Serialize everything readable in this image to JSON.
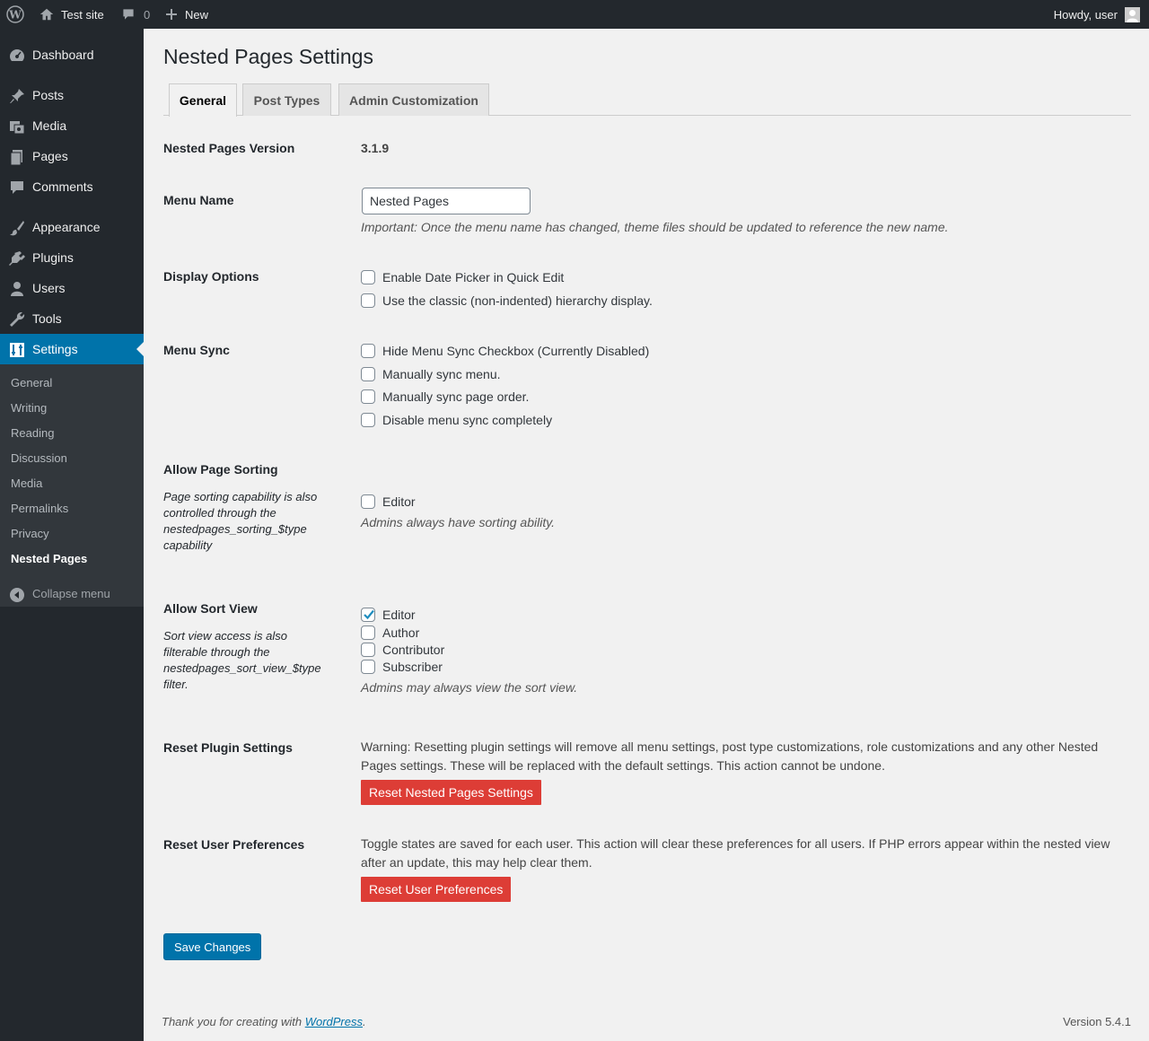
{
  "adminbar": {
    "site_name": "Test site",
    "comments_count": "0",
    "new_label": "New",
    "howdy": "Howdy, user"
  },
  "sidebar": {
    "items": [
      {
        "label": "Dashboard",
        "icon": "dashboard-icon"
      },
      {
        "label": "Posts",
        "icon": "pin-icon"
      },
      {
        "label": "Media",
        "icon": "media-icon"
      },
      {
        "label": "Pages",
        "icon": "pages-icon"
      },
      {
        "label": "Comments",
        "icon": "comment-icon"
      },
      {
        "label": "Appearance",
        "icon": "brush-icon"
      },
      {
        "label": "Plugins",
        "icon": "plug-icon"
      },
      {
        "label": "Users",
        "icon": "user-icon"
      },
      {
        "label": "Tools",
        "icon": "wrench-icon"
      },
      {
        "label": "Settings",
        "icon": "settings-icon"
      }
    ],
    "submenu": [
      "General",
      "Writing",
      "Reading",
      "Discussion",
      "Media",
      "Permalinks",
      "Privacy",
      "Nested Pages"
    ],
    "collapse": "Collapse menu"
  },
  "page": {
    "title": "Nested Pages Settings",
    "tabs": [
      "General",
      "Post Types",
      "Admin Customization"
    ]
  },
  "version": {
    "label": "Nested Pages Version",
    "value": "3.1.9"
  },
  "menu_name": {
    "label": "Menu Name",
    "value": "Nested Pages",
    "description": "Important: Once the menu name has changed, theme files should be updated to reference the new name."
  },
  "display_options": {
    "label": "Display Options",
    "options": [
      "Enable Date Picker in Quick Edit",
      "Use the classic (non-indented) hierarchy display."
    ]
  },
  "menu_sync": {
    "label": "Menu Sync",
    "options": [
      "Hide Menu Sync Checkbox (Currently Disabled)",
      "Manually sync menu.",
      "Manually sync page order.",
      "Disable menu sync completely"
    ]
  },
  "page_sorting": {
    "label": "Allow Page Sorting",
    "note": "Page sorting capability is also controlled through the nestedpages_sorting_$type capability",
    "options": [
      "Editor"
    ],
    "description": "Admins always have sorting ability."
  },
  "sort_view": {
    "label": "Allow Sort View",
    "note": "Sort view access is also filterable through the nestedpages_sort_view_$type filter.",
    "options": [
      "Editor",
      "Author",
      "Contributor",
      "Subscriber"
    ],
    "checked": [
      true,
      false,
      false,
      false
    ],
    "description": "Admins may always view the sort view."
  },
  "reset_plugin": {
    "label": "Reset Plugin Settings",
    "warning": "Warning: Resetting plugin settings will remove all menu settings, post type customizations, role customizations and any other Nested Pages settings. These will be replaced with the default settings. This action cannot be undone.",
    "button": "Reset Nested Pages Settings"
  },
  "reset_user": {
    "label": "Reset User Preferences",
    "text": "Toggle states are saved for each user. This action will clear these preferences for all users. If PHP errors appear within the nested view after an update, this may help clear them.",
    "button": "Reset User Preferences"
  },
  "save_button": "Save Changes",
  "footer": {
    "thanks": "Thank you for creating with ",
    "link": "WordPress",
    "period": ".",
    "version": "Version 5.4.1"
  },
  "colors": {
    "accent": "#0073aa",
    "danger": "#dd3d36",
    "sidebar": "#23282d"
  }
}
